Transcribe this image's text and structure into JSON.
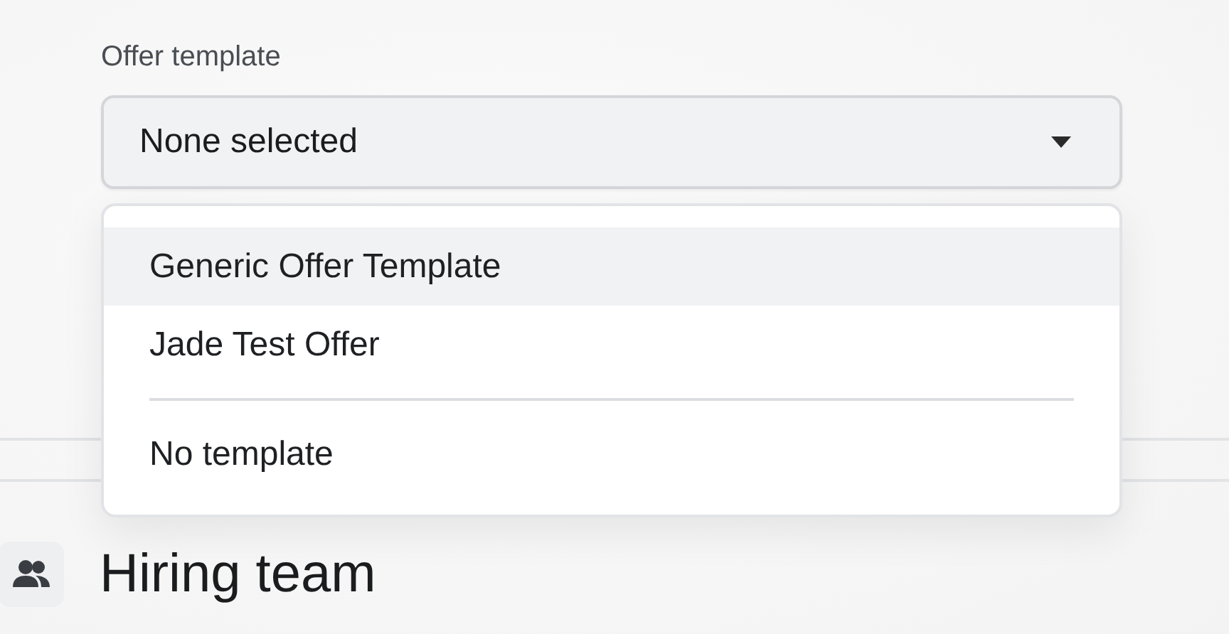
{
  "field": {
    "label": "Offer template",
    "value": "None selected"
  },
  "menu": {
    "items": [
      {
        "kind": "option",
        "label": "Generic Offer Template",
        "selected": true
      },
      {
        "kind": "option",
        "label": "Jade Test Offer",
        "selected": false
      },
      {
        "kind": "separator"
      },
      {
        "kind": "option",
        "label": "No template",
        "selected": false
      }
    ]
  },
  "section": {
    "title": "Hiring team"
  }
}
